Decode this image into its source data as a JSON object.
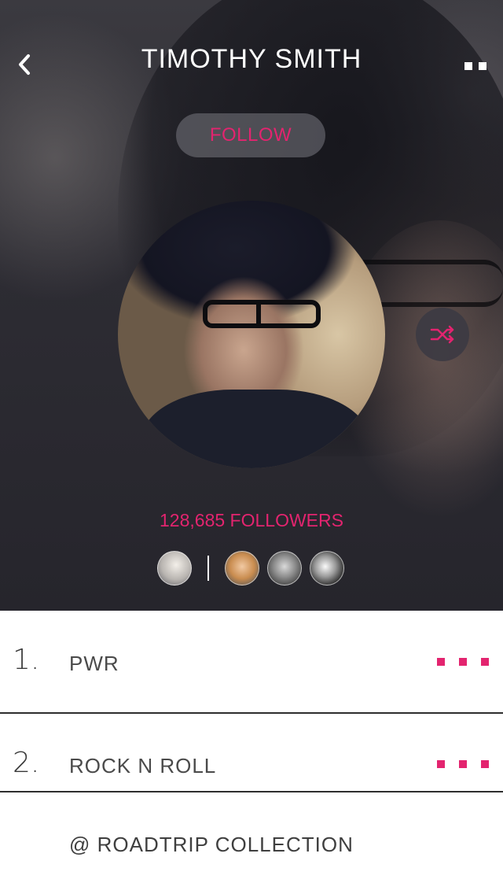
{
  "header": {
    "title": "TIMOTHY SMITH",
    "back_icon": "chevron-left-icon",
    "menu_icon": "more-icon"
  },
  "profile": {
    "follow_label": "FOLLOW",
    "followers_text": "128,685 FOLLOWERS",
    "shuffle_icon": "shuffle-icon"
  },
  "followers_preview": {
    "count_shown": 4
  },
  "tracks": [
    {
      "number": "1.",
      "title": "PWR"
    },
    {
      "number": "2.",
      "title": "ROCK N ROLL"
    }
  ],
  "collection": {
    "label": "@ ROADTRIP COLLECTION"
  },
  "colors": {
    "accent": "#e3246f",
    "hero_bg": "#2d2c33",
    "list_bg": "#ffffff",
    "text_dark": "#3a3a3a"
  }
}
